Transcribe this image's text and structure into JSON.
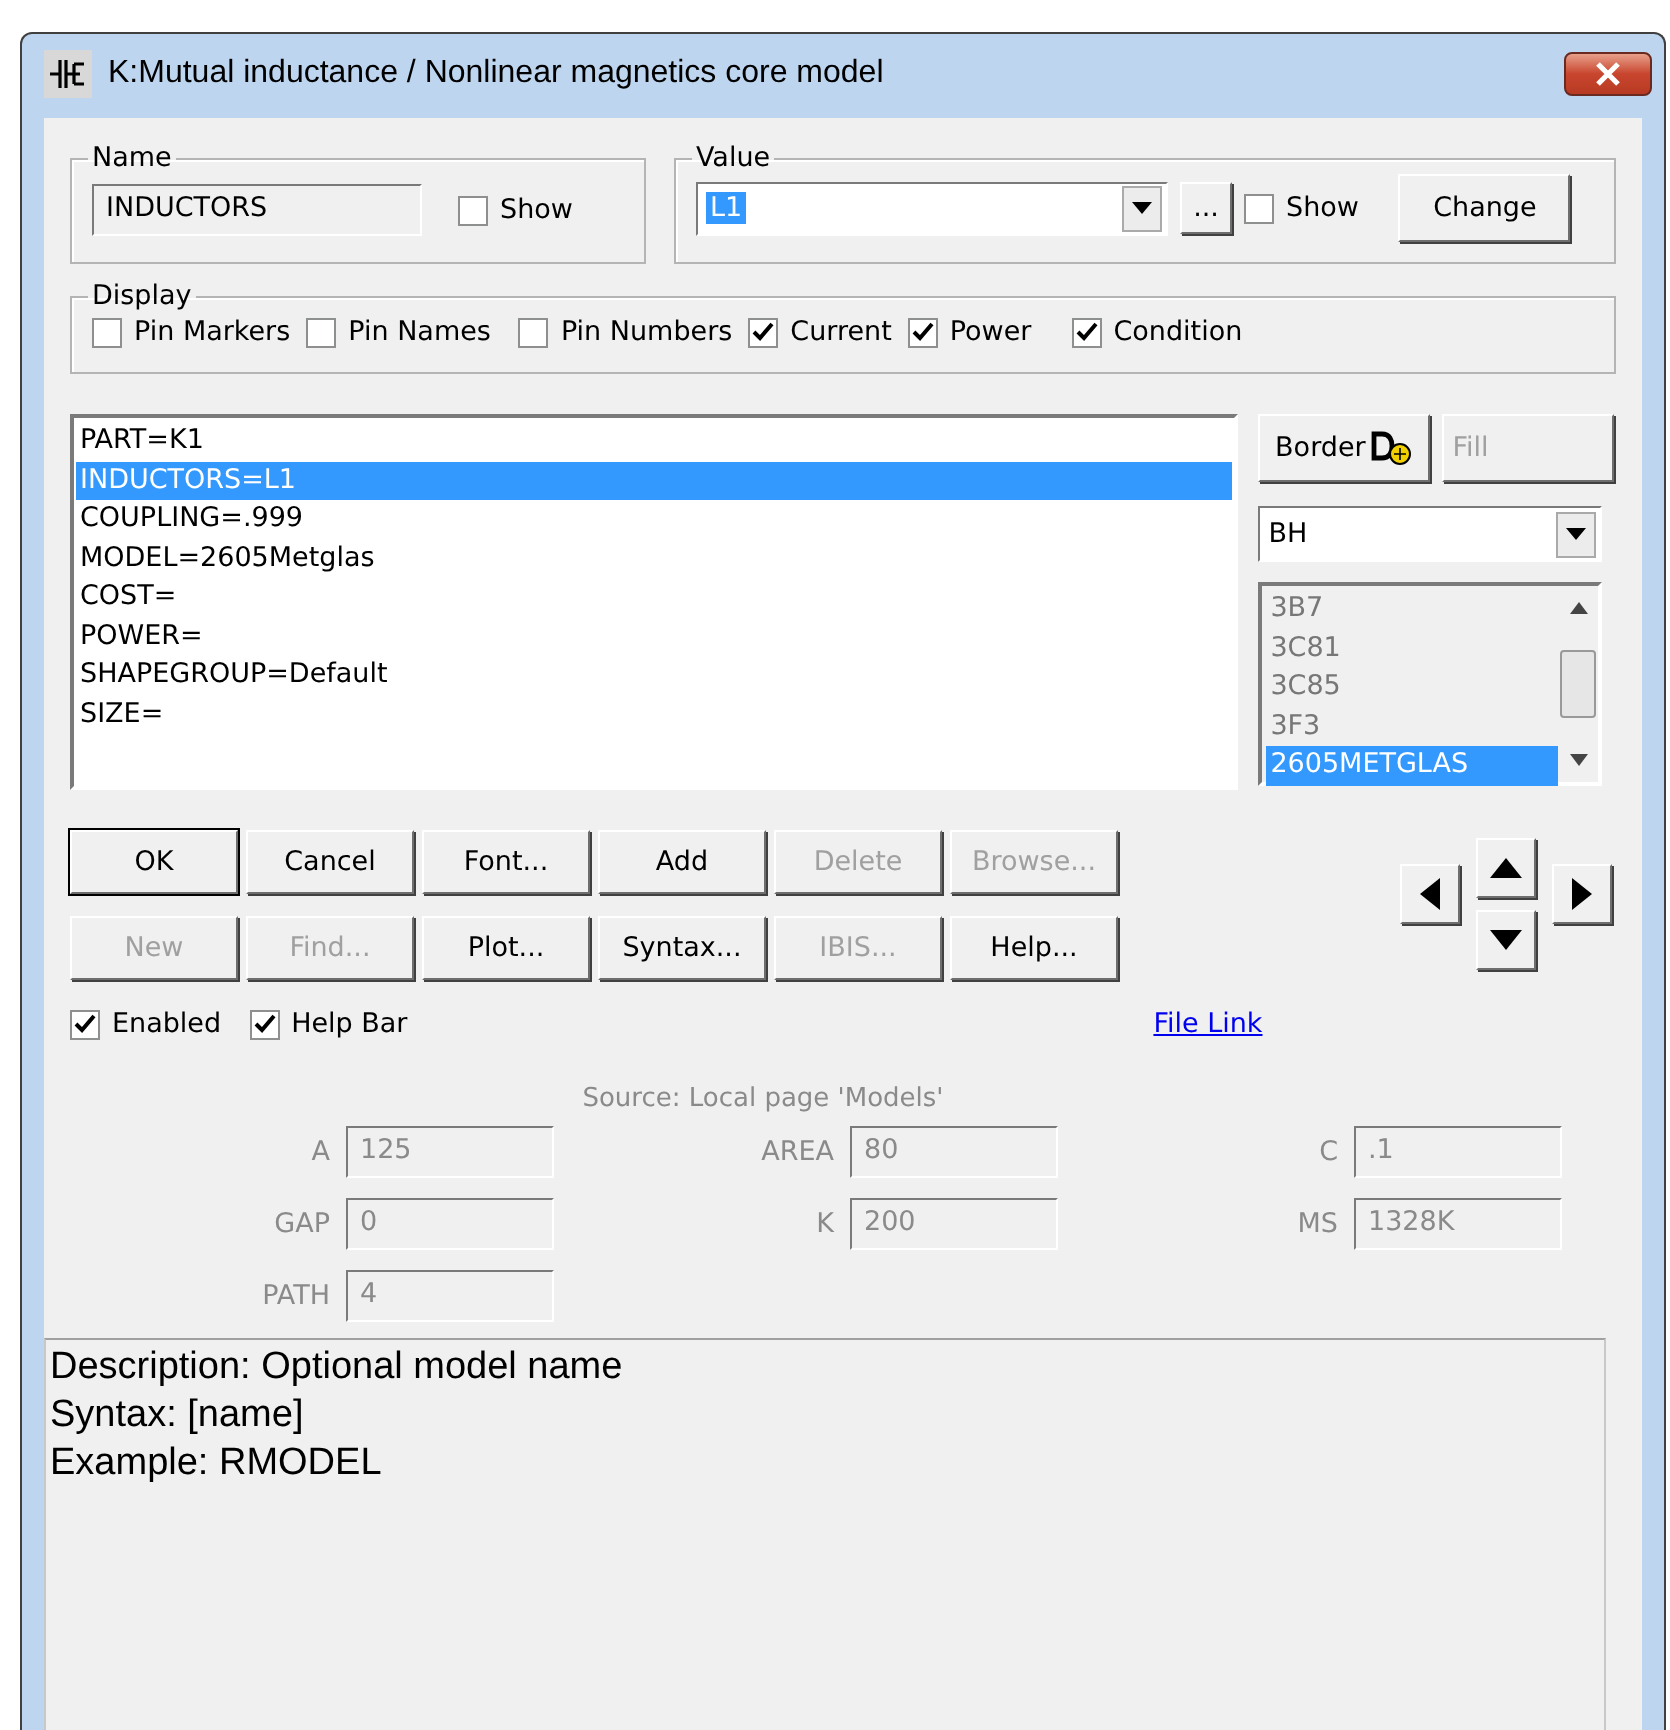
{
  "window": {
    "title": "K:Mutual inductance / Nonlinear magnetics core model"
  },
  "name_group": {
    "label": "Name",
    "value": "INDUCTORS",
    "show": {
      "label": "Show",
      "checked": false
    }
  },
  "value_group": {
    "label": "Value",
    "value": "L1",
    "browse_button": "...",
    "show": {
      "label": "Show",
      "checked": false
    },
    "change_button": "Change"
  },
  "display": {
    "label": "Display",
    "options": [
      {
        "label": "Pin Markers",
        "checked": false
      },
      {
        "label": "Pin Names",
        "checked": false
      },
      {
        "label": "Pin Numbers",
        "checked": false
      },
      {
        "label": "Current",
        "checked": true
      },
      {
        "label": "Power",
        "checked": true
      },
      {
        "label": "Condition",
        "checked": true
      }
    ]
  },
  "attributes": [
    {
      "text": "PART=K1",
      "selected": false
    },
    {
      "text": "INDUCTORS=L1",
      "selected": true
    },
    {
      "text": "COUPLING=.999",
      "selected": false
    },
    {
      "text": "MODEL=2605Metglas",
      "selected": false
    },
    {
      "text": "COST=",
      "selected": false
    },
    {
      "text": "POWER=",
      "selected": false
    },
    {
      "text": "SHAPEGROUP=Default",
      "selected": false
    },
    {
      "text": "SIZE=",
      "selected": false
    }
  ],
  "border_button": "Border",
  "fill_button": {
    "label": "Fill",
    "disabled": true
  },
  "model_type": "BH",
  "model_list": [
    {
      "text": "3B7",
      "selected": false
    },
    {
      "text": "3C81",
      "selected": false
    },
    {
      "text": "3C85",
      "selected": false
    },
    {
      "text": "3F3",
      "selected": false
    },
    {
      "text": "2605METGLAS",
      "selected": true
    }
  ],
  "button_rows": [
    [
      {
        "label": "OK",
        "disabled": false
      },
      {
        "label": "Cancel",
        "disabled": false
      },
      {
        "label": "Font...",
        "disabled": false
      },
      {
        "label": "Add",
        "disabled": false
      },
      {
        "label": "Delete",
        "disabled": true
      },
      {
        "label": "Browse...",
        "disabled": true
      }
    ],
    [
      {
        "label": "New",
        "disabled": true
      },
      {
        "label": "Find...",
        "disabled": true
      },
      {
        "label": "Plot...",
        "disabled": false
      },
      {
        "label": "Syntax...",
        "disabled": false
      },
      {
        "label": "IBIS...",
        "disabled": true
      },
      {
        "label": "Help...",
        "disabled": false
      }
    ]
  ],
  "options": [
    {
      "label": "Enabled",
      "checked": true
    },
    {
      "label": "Help Bar",
      "checked": true
    }
  ],
  "file_link": "File Link",
  "source": "Source: Local page 'Models'",
  "params_disabled": true,
  "params": [
    {
      "label": "A",
      "value": "125"
    },
    {
      "label": "AREA",
      "value": "80"
    },
    {
      "label": "C",
      "value": ".1"
    },
    {
      "label": "GAP",
      "value": "0"
    },
    {
      "label": "K",
      "value": "200"
    },
    {
      "label": "MS",
      "value": "1328K"
    },
    {
      "label": "PATH",
      "value": "4"
    }
  ],
  "help": [
    "Description: Optional model name",
    "Syntax: [name]",
    "Example: RMODEL"
  ]
}
